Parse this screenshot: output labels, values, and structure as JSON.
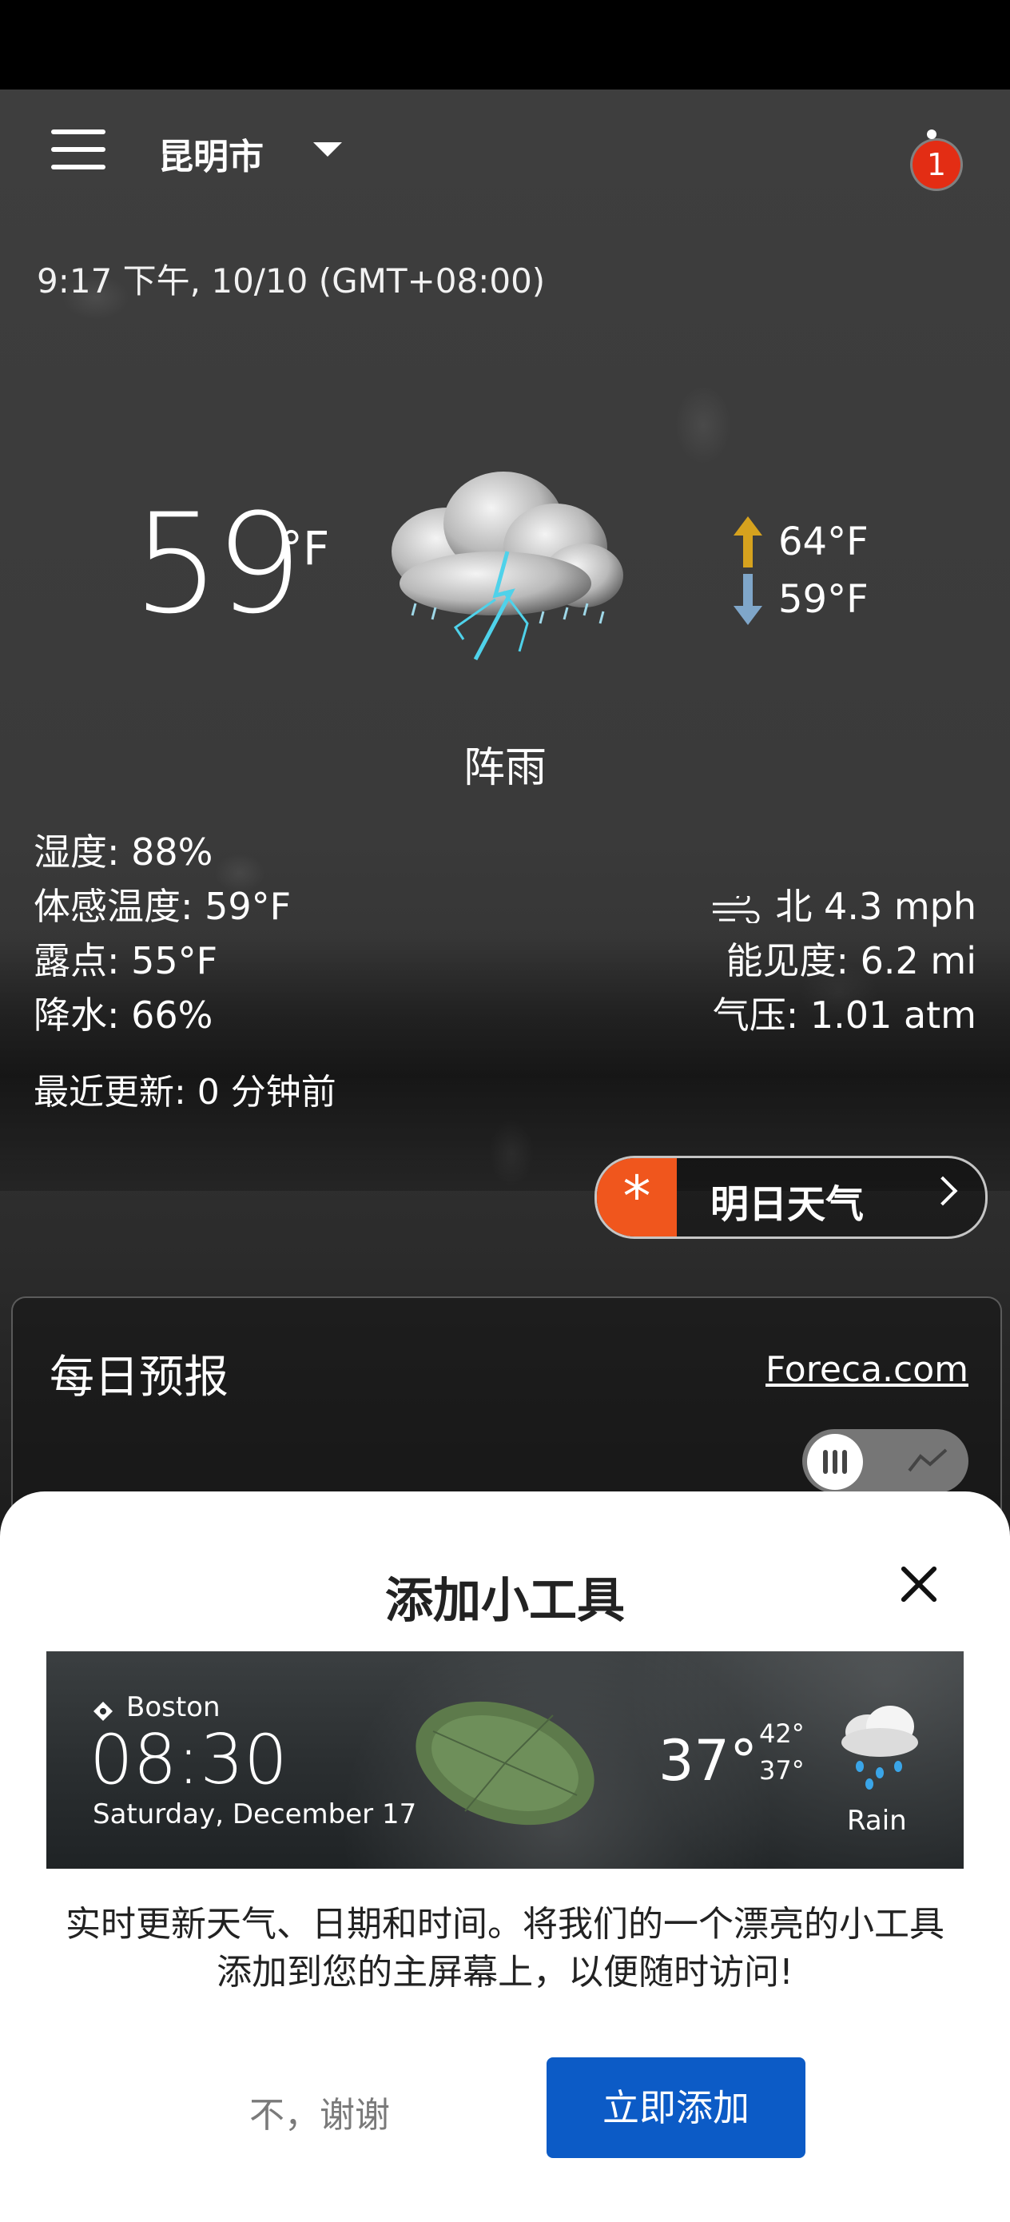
{
  "header": {
    "city": "昆明市",
    "notification_count": "1"
  },
  "datetime": "9:17 下午, 10/10 (GMT+08:00)",
  "current": {
    "temp": "59",
    "unit": "°F",
    "condition": "阵雨",
    "condition_icon": "thunderstorm-cloud-icon",
    "high": "64°F",
    "low": "59°F"
  },
  "details": {
    "humidity": "湿度: 88%",
    "feels_like": "体感温度:   59°F",
    "dew_point": "露点: 55°F",
    "precip": "降水: 66%",
    "wind": "北 4.3 mph",
    "visibility": "能见度: 6.2 mi",
    "pressure": "气压: 1.01 atm",
    "updated": "最近更新:   0 分钟前"
  },
  "tomorrow_button": {
    "label": "明日天气"
  },
  "daily": {
    "title": "每日预报",
    "source_link": "Foreca.com"
  },
  "sheet": {
    "title": "添加小工具",
    "description": "实时更新天气、日期和时间。将我们的一个漂亮的小工具添加到您的主屏幕上，以便随时访问!",
    "no_thanks": "不，谢谢",
    "add_now": "立即添加",
    "preview": {
      "location": "Boston",
      "time": "08:30",
      "date": "Saturday, December 17",
      "temp": "37°",
      "high": "42°",
      "low": "37°",
      "condition": "Rain"
    }
  },
  "colors": {
    "accent_orange": "#f0561d",
    "badge_red": "#e32d14",
    "primary_blue": "#0c5bc6",
    "arrow_up": "#d6a21e",
    "arrow_down": "#7fa6c9"
  }
}
